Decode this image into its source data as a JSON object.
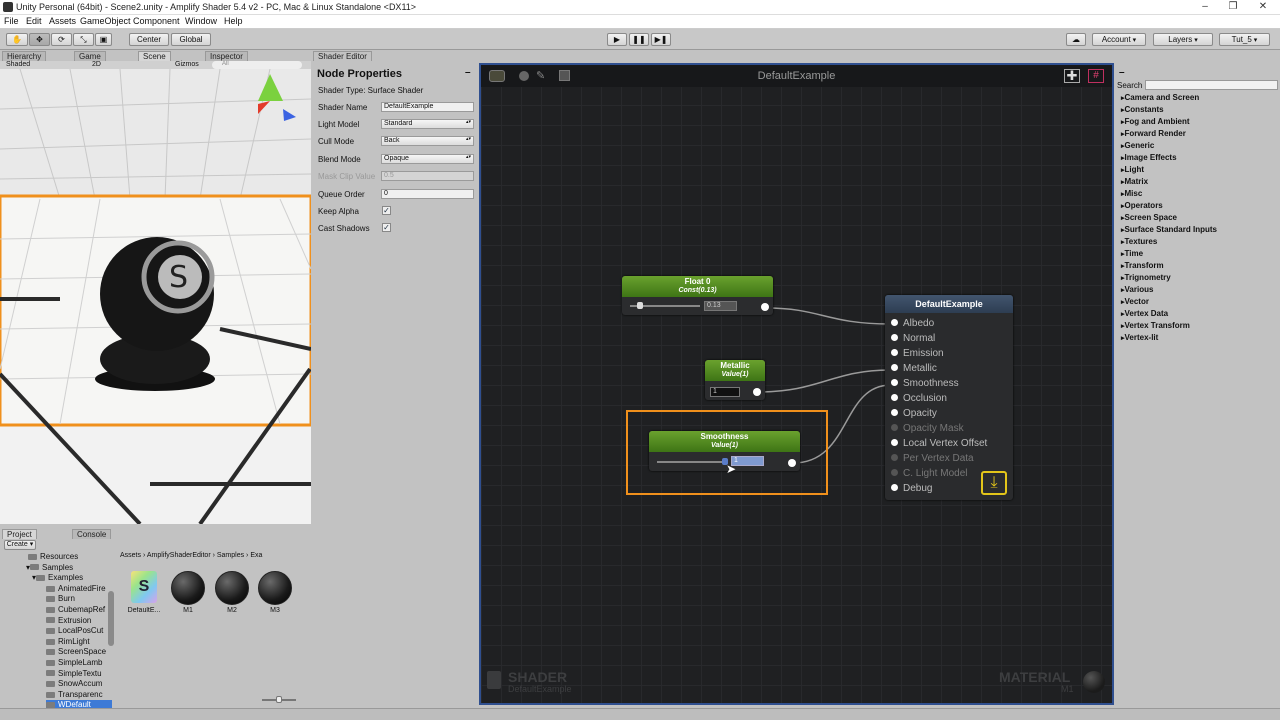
{
  "window": {
    "title": "Unity Personal (64bit) - Scene2.unity - Amplify Shader 5.4 v2 - PC, Mac & Linux Standalone <DX11>"
  },
  "menu": [
    "File",
    "Edit",
    "Assets",
    "GameObject",
    "Component",
    "Window",
    "Help"
  ],
  "toolbar": {
    "center": "Center",
    "global": "Global",
    "account": "Account",
    "layers": "Layers",
    "layout": "Tut_5"
  },
  "tabs": {
    "hierarchy": "Hierarchy",
    "game": "Game",
    "scene": "Scene",
    "inspector": "Inspector",
    "shader_editor": "Shader Editor",
    "project": "Project",
    "console": "Console"
  },
  "scene_bar": {
    "shading": "Shaded",
    "mode": "2D",
    "gizmos": "Gizmos",
    "search": "All"
  },
  "node_properties": {
    "title": "Node Properties",
    "shader_type": "Shader Type: Surface Shader",
    "rows": [
      {
        "label": "Shader Name",
        "value": "DefaultExample"
      },
      {
        "label": "Light Model",
        "value": "Standard"
      },
      {
        "label": "Cull Mode",
        "value": "Back"
      },
      {
        "label": "Blend Mode",
        "value": "Opaque"
      },
      {
        "label": "Mask Clip Value",
        "value": "0.5"
      },
      {
        "label": "Queue Order",
        "value": "0"
      },
      {
        "label": "Keep Alpha",
        "value": "✓"
      },
      {
        "label": "Cast Shadows",
        "value": "✓"
      }
    ]
  },
  "canvas": {
    "title": "DefaultExample",
    "footer_left_big": "SHADER",
    "footer_left_small": "DefaultExample",
    "footer_right_big": "MATERIAL",
    "footer_right_small": "M1"
  },
  "nodes": {
    "float0": {
      "title": "Float 0",
      "subtitle": "Const(0.13)",
      "value": "0.13"
    },
    "metallic": {
      "title": "Metallic",
      "subtitle": "Value(1)",
      "value": "1"
    },
    "smoothness": {
      "title": "Smoothness",
      "subtitle": "Value(1)",
      "value": "1"
    },
    "output": {
      "title": "DefaultExample",
      "inputs": [
        "Albedo",
        "Normal",
        "Emission",
        "Metallic",
        "Smoothness",
        "Occlusion",
        "Opacity",
        "Opacity Mask",
        "Local Vertex Offset",
        "Per Vertex Data",
        "C. Light Model",
        "Debug"
      ]
    }
  },
  "palette": {
    "search_label": "Search",
    "categories": [
      "Camera and Screen",
      "Constants",
      "Fog and Ambient",
      "Forward Render",
      "Generic",
      "Image Effects",
      "Light",
      "Matrix",
      "Misc",
      "Operators",
      "Screen Space",
      "Surface Standard Inputs",
      "Textures",
      "Time",
      "Transform",
      "Trignometry",
      "Various",
      "Vector",
      "Vertex Data",
      "Vertex Transform",
      "Vertex-lit"
    ]
  },
  "project": {
    "create": "Create",
    "breadcrumb": "Assets › AmplifyShaderEditor › Samples › Exa",
    "tree": [
      "Resources",
      "Samples",
      "Examples",
      "AnimatedFire",
      "Burn",
      "CubemapRef",
      "Extrusion",
      "LocalPosCut",
      "RimLight",
      "ScreenSpace",
      "SimpleLamb",
      "SimpleTextu",
      "SnowAccum",
      "Transparenc",
      "WDefault"
    ],
    "assets": [
      "DefaultE...",
      "M1",
      "M2",
      "M3"
    ]
  }
}
